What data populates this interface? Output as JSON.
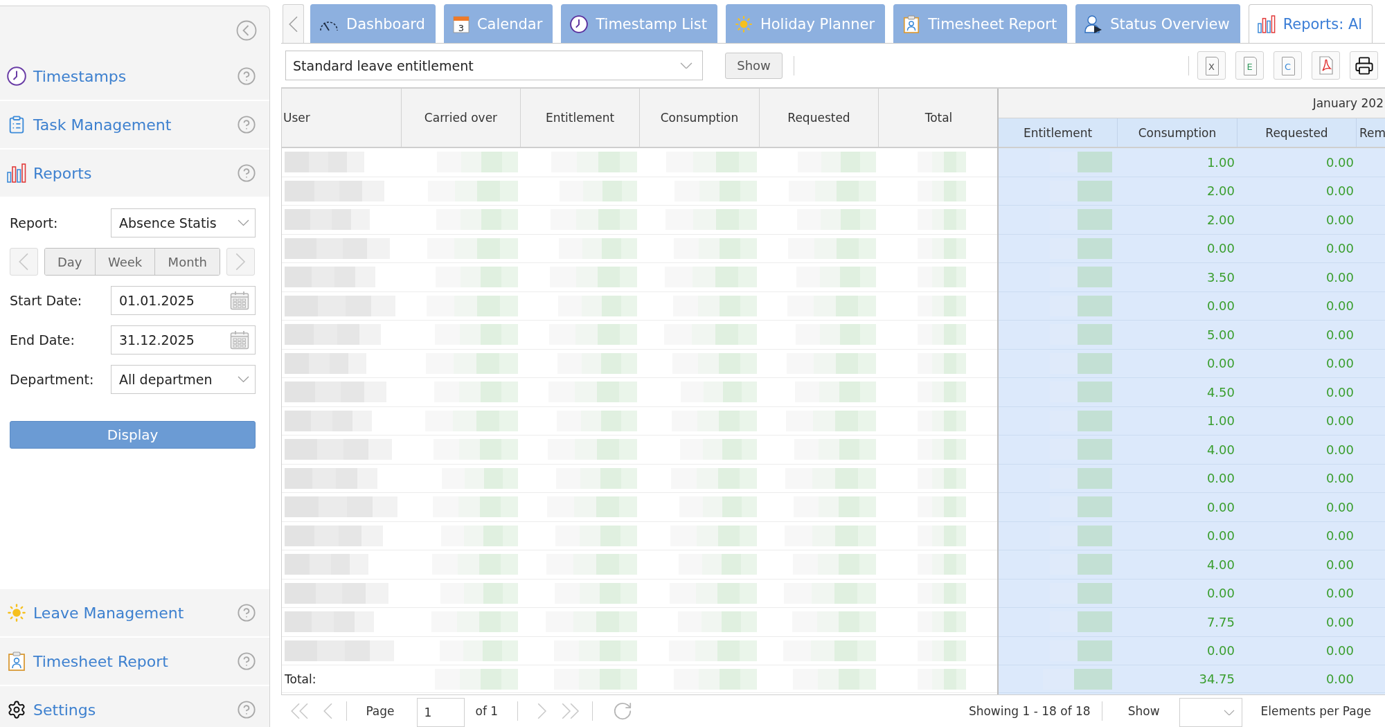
{
  "sidebar": {
    "modules_top": [
      {
        "label": "Timestamps"
      },
      {
        "label": "Task Management"
      },
      {
        "label": "Reports"
      }
    ],
    "report_form": {
      "fields": [
        {
          "kind": "select",
          "label": "Report:",
          "value": "Absence Statis"
        },
        {
          "kind": "period",
          "options": [
            {
              "label": "Day",
              "selected": false
            },
            {
              "label": "Week",
              "selected": false
            },
            {
              "label": "Month",
              "selected": false
            }
          ]
        },
        {
          "kind": "date",
          "label": "Start Date:",
          "value": "01.01.2025"
        },
        {
          "kind": "date",
          "label": "End Date:",
          "value": "31.12.2025"
        },
        {
          "kind": "select",
          "label": "Department:",
          "value": "All departmen"
        }
      ],
      "submit": "Display"
    },
    "modules_bottom": [
      {
        "label": "Leave Management"
      },
      {
        "label": "Timesheet Report"
      },
      {
        "label": "Settings"
      }
    ]
  },
  "tabs": [
    {
      "label": "Dashboard",
      "selected": false
    },
    {
      "label": "Calendar",
      "selected": false,
      "icon_text": "3"
    },
    {
      "label": "Timestamp List",
      "selected": false
    },
    {
      "label": "Holiday Planner",
      "selected": false
    },
    {
      "label": "Timesheet Report",
      "selected": false
    },
    {
      "label": "Status Overview",
      "selected": false
    },
    {
      "label": "Reports: Al",
      "selected": true
    }
  ],
  "toolbar": {
    "report_select": "Standard leave entitlement",
    "show_button": "Show",
    "exports": [
      {
        "kind": "letter",
        "label": "X",
        "color": "#555555"
      },
      {
        "kind": "letter",
        "label": "E",
        "color": "#2f9a5c"
      },
      {
        "kind": "letter",
        "label": "C",
        "color": "#3a8ad8"
      },
      {
        "kind": "pdf"
      },
      {
        "kind": "print"
      }
    ]
  },
  "table": {
    "columns": [
      "User",
      "Carried over",
      "Entitlement",
      "Consumption",
      "Requested",
      "Total"
    ],
    "month_group": {
      "title": "January 202",
      "columns": [
        "Entitlement",
        "Consumption",
        "Requested",
        "Rem"
      ]
    },
    "rows": [
      {
        "consumption": "1.00",
        "requested": "0.00"
      },
      {
        "consumption": "2.00",
        "requested": "0.00"
      },
      {
        "consumption": "2.00",
        "requested": "0.00"
      },
      {
        "consumption": "0.00",
        "requested": "0.00"
      },
      {
        "consumption": "3.50",
        "requested": "0.00"
      },
      {
        "consumption": "0.00",
        "requested": "0.00"
      },
      {
        "consumption": "5.00",
        "requested": "0.00"
      },
      {
        "consumption": "0.00",
        "requested": "0.00"
      },
      {
        "consumption": "4.50",
        "requested": "0.00"
      },
      {
        "consumption": "1.00",
        "requested": "0.00"
      },
      {
        "consumption": "4.00",
        "requested": "0.00"
      },
      {
        "consumption": "0.00",
        "requested": "0.00"
      },
      {
        "consumption": "0.00",
        "requested": "0.00"
      },
      {
        "consumption": "0.00",
        "requested": "0.00"
      },
      {
        "consumption": "4.00",
        "requested": "0.00"
      },
      {
        "consumption": "0.00",
        "requested": "0.00"
      },
      {
        "consumption": "7.75",
        "requested": "0.00"
      },
      {
        "consumption": "0.00",
        "requested": "0.00"
      }
    ],
    "total": {
      "label": "Total:",
      "consumption": "34.75",
      "requested": "0.00"
    }
  },
  "pagination": {
    "page_label": "Page",
    "page_value": "1",
    "page_count": "of 1",
    "summary": "Showing 1 - 18 of 18",
    "show_label": "Show",
    "per_page_label": "Elements per Page"
  }
}
